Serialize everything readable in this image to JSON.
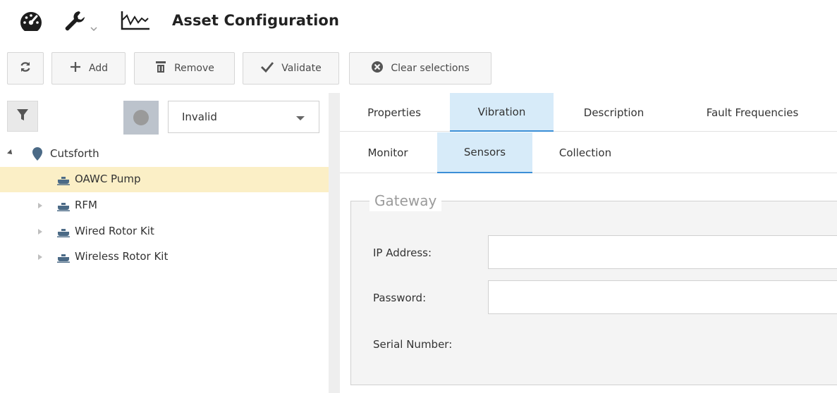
{
  "header": {
    "title": "Asset Configuration",
    "icons": [
      "dashboard-gauge-icon",
      "wrench-icon",
      "trend-chart-icon"
    ]
  },
  "toolbar": {
    "refresh_icon": "refresh-icon",
    "add_label": "Add",
    "remove_label": "Remove",
    "validate_label": "Validate",
    "clear_label": "Clear selections"
  },
  "filter": {
    "status_selected": "Invalid"
  },
  "tree": {
    "root": {
      "label": "Cutsforth",
      "icon": "location-pin-icon",
      "expanded": true
    },
    "items": [
      {
        "label": "OAWC Pump",
        "icon": "pump-icon",
        "selected": true,
        "expandable": false
      },
      {
        "label": "RFM",
        "icon": "pump-icon",
        "selected": false,
        "expandable": true
      },
      {
        "label": "Wired Rotor Kit",
        "icon": "pump-icon",
        "selected": false,
        "expandable": true
      },
      {
        "label": "Wireless Rotor Kit",
        "icon": "pump-icon",
        "selected": false,
        "expandable": true
      }
    ]
  },
  "tabs_primary": [
    {
      "label": "Properties",
      "active": false
    },
    {
      "label": "Vibration",
      "active": true
    },
    {
      "label": "Description",
      "active": false
    },
    {
      "label": "Fault Frequencies",
      "active": false
    }
  ],
  "tabs_secondary": [
    {
      "label": "Monitor",
      "active": false
    },
    {
      "label": "Sensors",
      "active": true
    },
    {
      "label": "Collection",
      "active": false
    }
  ],
  "gateway": {
    "legend": "Gateway",
    "ip_label": "IP Address:",
    "ip_value": "",
    "password_label": "Password:",
    "password_value": "",
    "serial_label": "Serial Number:",
    "serial_value": ""
  },
  "colors": {
    "selected_row": "#fbefc6",
    "active_tab": "#d7ebf9",
    "active_tab_underline": "#3b8fd6"
  }
}
